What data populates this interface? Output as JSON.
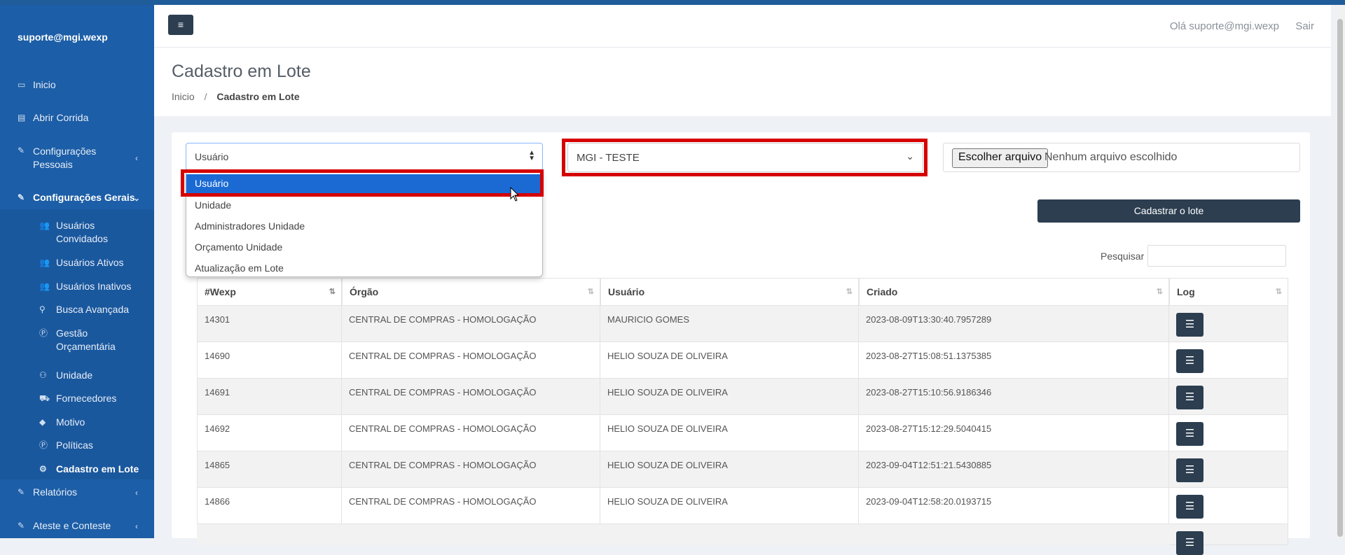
{
  "sidebar": {
    "user": "suporte@mgi.wexp",
    "items": [
      {
        "icon": "laptop-icon",
        "label": "Inicio"
      },
      {
        "icon": "calendar-icon",
        "label": "Abrir Corrida"
      },
      {
        "icon": "edit-icon",
        "label": "Configurações Pessoais"
      },
      {
        "icon": "edit-icon",
        "label": "Configurações Gerais"
      },
      {
        "icon": "edit-icon",
        "label": "Relatórios"
      },
      {
        "icon": "edit-icon",
        "label": "Ateste e Conteste"
      }
    ],
    "subitems": [
      {
        "icon": "users-icon",
        "label": "Usuários Convidados"
      },
      {
        "icon": "users-icon",
        "label": "Usuários Ativos"
      },
      {
        "icon": "users-icon",
        "label": "Usuários Inativos"
      },
      {
        "icon": "search-icon",
        "label": "Busca Avançada"
      },
      {
        "icon": "p-circle-icon",
        "label": "Gestão Orçamentária"
      },
      {
        "icon": "network-icon",
        "label": "Unidade"
      },
      {
        "icon": "car-icon",
        "label": "Fornecedores"
      },
      {
        "icon": "tag-icon",
        "label": "Motivo"
      },
      {
        "icon": "p-circle-icon",
        "label": "Políticas"
      },
      {
        "icon": "gears-icon",
        "label": "Cadastro em Lote"
      }
    ]
  },
  "header": {
    "greeting": "Olá suporte@mgi.wexp",
    "logout": "Sair"
  },
  "page": {
    "title": "Cadastro em Lote",
    "breadcrumb_home": "Inicio",
    "breadcrumb_sep": "/",
    "breadcrumb_current": "Cadastro em Lote"
  },
  "form": {
    "type_select_value": "Usuário",
    "type_options": [
      "Usuário",
      "Unidade",
      "Administradores Unidade",
      "Orçamento Unidade",
      "Atualização em Lote"
    ],
    "org_select_value": "MGI - TESTE",
    "file_button": "Escolher arquivo",
    "file_status": "Nenhum arquivo escolhido",
    "submit_label": "Cadastrar o lote",
    "search_label": "Pesquisar"
  },
  "table": {
    "columns": [
      "#Wexp",
      "Órgão",
      "Usuário",
      "Criado",
      "Log"
    ],
    "rows": [
      [
        "14301",
        "CENTRAL DE COMPRAS - HOMOLOGAÇÃO",
        "MAURICIO GOMES",
        "2023-08-09T13:30:40.7957289"
      ],
      [
        "14690",
        "CENTRAL DE COMPRAS - HOMOLOGAÇÃO",
        "HELIO SOUZA DE OLIVEIRA",
        "2023-08-27T15:08:51.1375385"
      ],
      [
        "14691",
        "CENTRAL DE COMPRAS - HOMOLOGAÇÃO",
        "HELIO SOUZA DE OLIVEIRA",
        "2023-08-27T15:10:56.9186346"
      ],
      [
        "14692",
        "CENTRAL DE COMPRAS - HOMOLOGAÇÃO",
        "HELIO SOUZA DE OLIVEIRA",
        "2023-08-27T15:12:29.5040415"
      ],
      [
        "14865",
        "CENTRAL DE COMPRAS - HOMOLOGAÇÃO",
        "HELIO SOUZA DE OLIVEIRA",
        "2023-09-04T12:51:21.5430885"
      ],
      [
        "14866",
        "CENTRAL DE COMPRAS - HOMOLOGAÇÃO",
        "HELIO SOUZA DE OLIVEIRA",
        "2023-09-04T12:58:20.0193715"
      ]
    ]
  }
}
